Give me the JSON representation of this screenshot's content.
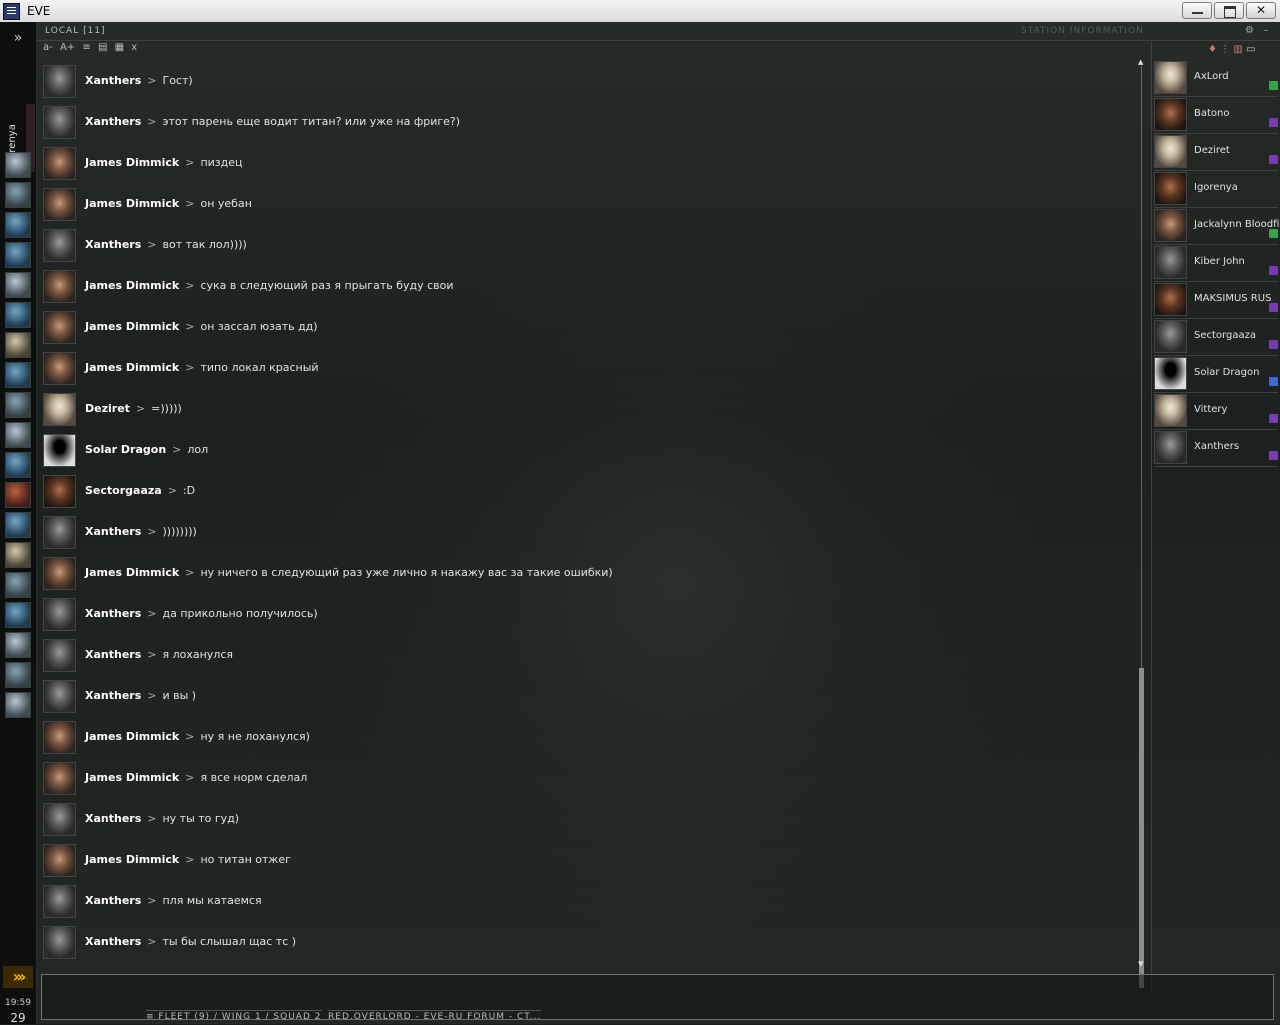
{
  "window": {
    "title": "EVE",
    "close_label": "✕"
  },
  "neocom": {
    "character_name": "Igorenya",
    "expand_label": "»",
    "time": "19:59",
    "day": "29"
  },
  "chat": {
    "title": "LOCAL [11]",
    "background_title": "STATION INFORMATION",
    "toolbar": [
      "a-",
      "A+",
      "≡",
      "▤",
      "▦",
      "x"
    ],
    "messages": [
      {
        "sender": "Xanthers",
        "text": "Гост)",
        "avatar": "xanthers-avatar"
      },
      {
        "sender": "Xanthers",
        "text": "этот парень еще водит титан? или уже на фриге?)",
        "avatar": "xanthers-avatar"
      },
      {
        "sender": "James Dimmick",
        "text": "пиздец",
        "avatar": "james-avatar"
      },
      {
        "sender": "James Dimmick",
        "text": "он уебан",
        "avatar": "james-avatar"
      },
      {
        "sender": "Xanthers",
        "text": "вот так лол))))",
        "avatar": "xanthers-avatar"
      },
      {
        "sender": "James Dimmick",
        "text": "сука в следующий раз я прыгать буду свои",
        "avatar": "james-avatar"
      },
      {
        "sender": "James Dimmick",
        "text": "он зассал юзать дд)",
        "avatar": "james-avatar"
      },
      {
        "sender": "James Dimmick",
        "text": "типо локал красный",
        "avatar": "james-avatar"
      },
      {
        "sender": "Deziret",
        "text": "=)))))",
        "avatar": "deziret-avatar"
      },
      {
        "sender": "Solar Dragon",
        "text": "лол",
        "avatar": "silhouette-avatar"
      },
      {
        "sender": "Sectorgaaza",
        "text": ":D",
        "avatar": "sectorgaaza-avatar"
      },
      {
        "sender": "Xanthers",
        "text": "))))))))",
        "avatar": "xanthers-avatar"
      },
      {
        "sender": "James Dimmick",
        "text": "ну ничего в следующий раз уже лично я накажу вас за такие ошибки)",
        "avatar": "james-avatar"
      },
      {
        "sender": "Xanthers",
        "text": "да прикольно получилось)",
        "avatar": "xanthers-avatar"
      },
      {
        "sender": "Xanthers",
        "text": "я лоханулся",
        "avatar": "xanthers-avatar"
      },
      {
        "sender": "Xanthers",
        "text": "и вы )",
        "avatar": "xanthers-avatar"
      },
      {
        "sender": "James Dimmick",
        "text": "ну я не лоханулся)",
        "avatar": "james-avatar"
      },
      {
        "sender": "James Dimmick",
        "text": "я все норм сделал",
        "avatar": "james-avatar"
      },
      {
        "sender": "Xanthers",
        "text": "ну ты то гуд)",
        "avatar": "xanthers-avatar"
      },
      {
        "sender": "James Dimmick",
        "text": "но титан отжег",
        "avatar": "james-avatar"
      },
      {
        "sender": "Xanthers",
        "text": "пля мы катаемся",
        "avatar": "xanthers-avatar"
      },
      {
        "sender": "Xanthers",
        "text": "ты бы слышал щас тс )",
        "avatar": "xanthers-avatar"
      }
    ],
    "separator": ">"
  },
  "members": [
    {
      "name": "AxLord",
      "badge": "green"
    },
    {
      "name": "Batono",
      "badge": "purple"
    },
    {
      "name": "Deziret",
      "badge": "purple"
    },
    {
      "name": "Igorenya",
      "badge": ""
    },
    {
      "name": "Jackalynn Bloodfis",
      "badge": "green"
    },
    {
      "name": "Kiber John",
      "badge": "purple"
    },
    {
      "name": "MAKSIMUS RUS",
      "badge": "purple"
    },
    {
      "name": "Sectorgaaza",
      "badge": "purple"
    },
    {
      "name": "Solar Dragon",
      "badge": "blue"
    },
    {
      "name": "Vittery",
      "badge": "purple"
    },
    {
      "name": "Xanthers",
      "badge": "purple"
    }
  ],
  "bottom_tabs": [
    {
      "label": "≡ FLEET (9) / WING 1 / SQUAD 2"
    },
    {
      "label": "RED.OVERLORD - EVE-RU FORUM - CT..."
    }
  ],
  "colors": {
    "sender": "#ffffff",
    "badge_green": "#2fa84a",
    "badge_purple": "#7a3ab8",
    "badge_blue": "#3a6ad8",
    "neocom_accent": "#f5b800"
  }
}
